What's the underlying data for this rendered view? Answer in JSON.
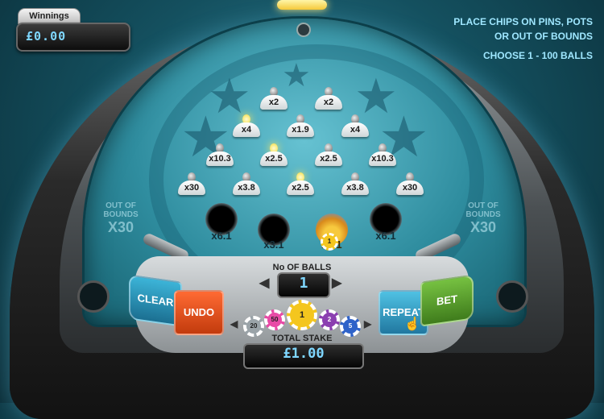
{
  "winnings": {
    "label": "Winnings",
    "value": "£0.00"
  },
  "instructions": {
    "line1": "PLACE CHIPS ON PINS, POTS",
    "line2": "OR OUT OF BOUNDS",
    "line3": "CHOOSE 1 - 100 BALLS"
  },
  "board": {
    "pins": [
      {
        "label": "x2",
        "lit": false
      },
      {
        "label": "x2",
        "lit": false
      },
      {
        "label": "x4",
        "lit": true
      },
      {
        "label": "x1.9",
        "lit": false
      },
      {
        "label": "x4",
        "lit": false
      },
      {
        "label": "x10.3",
        "lit": false
      },
      {
        "label": "x2.5",
        "lit": true
      },
      {
        "label": "x2.5",
        "lit": false
      },
      {
        "label": "x10.3",
        "lit": false
      },
      {
        "label": "x30",
        "lit": false
      },
      {
        "label": "x3.8",
        "lit": false
      },
      {
        "label": "x2.5",
        "lit": true
      },
      {
        "label": "x3.8",
        "lit": false
      },
      {
        "label": "x30",
        "lit": false
      }
    ],
    "pots": [
      {
        "label": "x6.1"
      },
      {
        "label": "x3.1"
      },
      {
        "label": "x3.1"
      },
      {
        "label": "x6.1"
      }
    ],
    "out_of_bounds_left": {
      "line1": "OUT OF",
      "line2": "BOUNDS",
      "line3": "X30"
    },
    "out_of_bounds_right": {
      "line1": "OUT OF",
      "line2": "BOUNDS",
      "line3": "X30"
    }
  },
  "controls": {
    "clear_label": "CLEAR",
    "undo_label": "UNDO",
    "repeat_label": "REPEAT",
    "bet_label": "BET",
    "balls_label": "No OF BALLS",
    "balls_value": "1",
    "stake_label": "TOTAL STAKE",
    "stake_value": "£1.00",
    "chips": [
      {
        "label": "20",
        "color": "#9aa3a8"
      },
      {
        "label": "50",
        "color": "#e84aa6"
      },
      {
        "label": "1",
        "color": "#f4c61e"
      },
      {
        "label": "2",
        "color": "#8b3fb0"
      },
      {
        "label": "5",
        "color": "#2f63c9"
      }
    ]
  },
  "colors": {
    "dome": "#2f8d9f",
    "clear": "#2a95bd",
    "undo": "#e4521d",
    "repeat": "#3499c1",
    "bet": "#5a9f2d",
    "display_text": "#7fd7ff"
  }
}
